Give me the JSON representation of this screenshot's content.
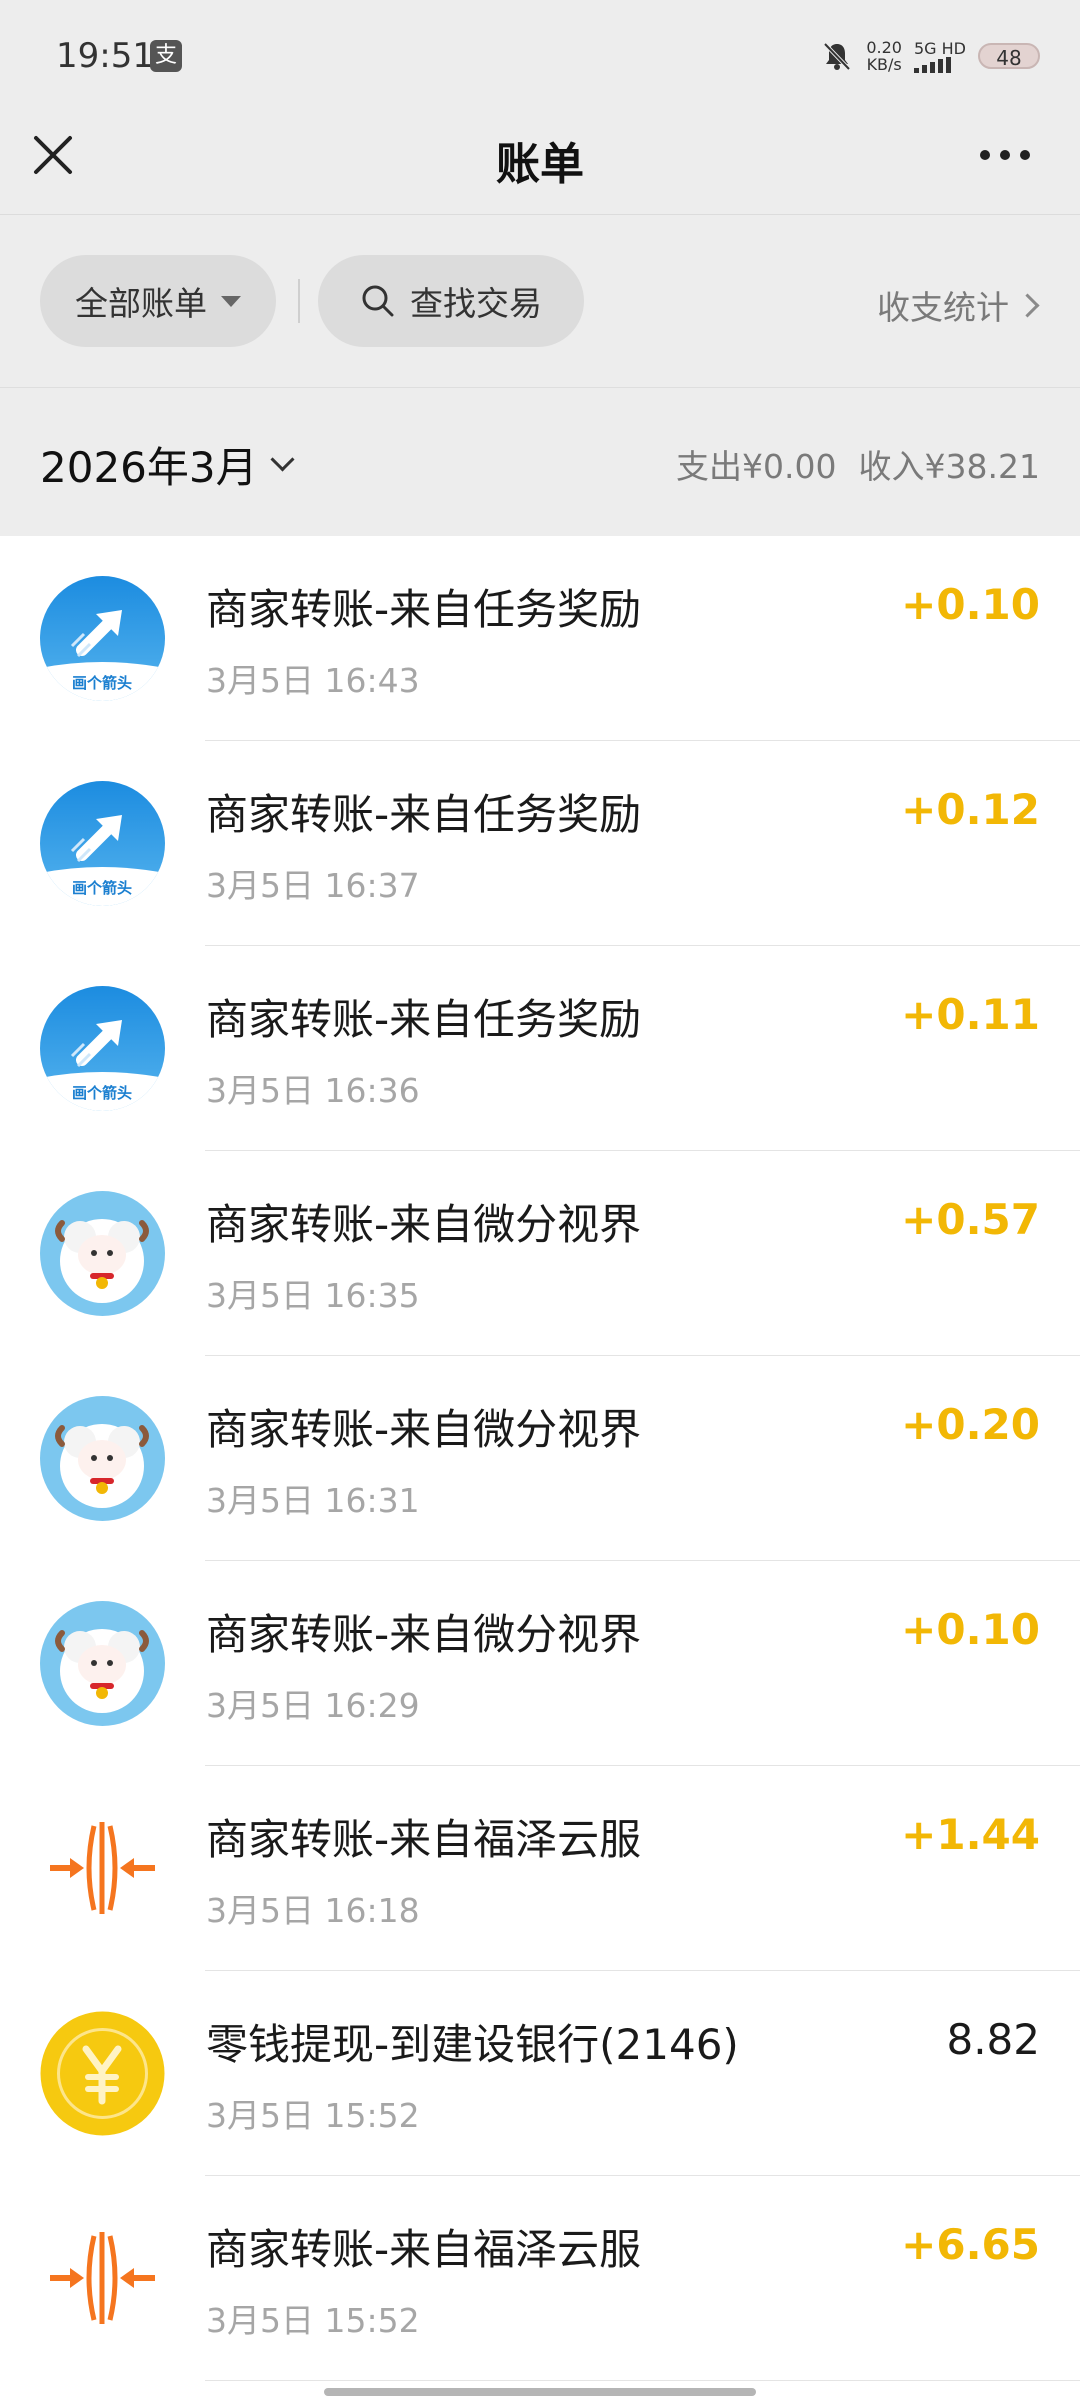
{
  "status_bar": {
    "time": "19:51",
    "app_badge": "支",
    "net_speed_value": "0.20",
    "net_speed_unit": "KB/s",
    "network": "5G HD",
    "battery": "48"
  },
  "nav": {
    "title": "账单",
    "close_icon": "close-icon",
    "more_icon": "more-icon"
  },
  "filters": {
    "all_bills": "全部账单",
    "search": "查找交易",
    "stats": "收支统计"
  },
  "month": {
    "label": "2026年3月",
    "expense": "支出¥0.00",
    "income": "收入¥38.21"
  },
  "colors": {
    "income_amount": "#f2b705",
    "background_header": "#ededed"
  },
  "transactions": [
    {
      "title": "商家转账-来自任务奖励",
      "time": "3月5日 16:43",
      "amount": "+0.10",
      "avatar": "arrow-task-icon",
      "avatar_caption": "画个箭头"
    },
    {
      "title": "商家转账-来自任务奖励",
      "time": "3月5日 16:37",
      "amount": "+0.12",
      "avatar": "arrow-task-icon",
      "avatar_caption": "画个箭头"
    },
    {
      "title": "商家转账-来自任务奖励",
      "time": "3月5日 16:36",
      "amount": "+0.11",
      "avatar": "arrow-task-icon",
      "avatar_caption": "画个箭头"
    },
    {
      "title": "商家转账-来自微分视界",
      "time": "3月5日 16:35",
      "amount": "+0.57",
      "avatar": "sheep-icon"
    },
    {
      "title": "商家转账-来自微分视界",
      "time": "3月5日 16:31",
      "amount": "+0.20",
      "avatar": "sheep-icon"
    },
    {
      "title": "商家转账-来自微分视界",
      "time": "3月5日 16:29",
      "amount": "+0.10",
      "avatar": "sheep-icon"
    },
    {
      "title": "商家转账-来自福泽云服",
      "time": "3月5日 16:18",
      "amount": "+1.44",
      "avatar": "orange-arrows-icon"
    },
    {
      "title": "零钱提现-到建设银行(2146)",
      "time": "3月5日 15:52",
      "amount": "8.82",
      "avatar": "yuan-coin-icon"
    },
    {
      "title": "商家转账-来自福泽云服",
      "time": "3月5日 15:52",
      "amount": "+6.65",
      "avatar": "orange-arrows-icon"
    }
  ]
}
